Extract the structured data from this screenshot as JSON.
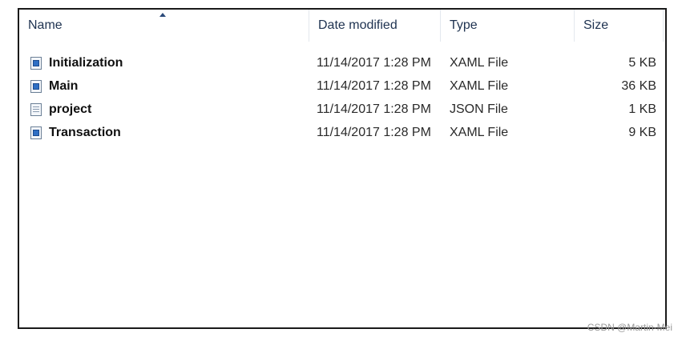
{
  "columns": {
    "name": "Name",
    "date": "Date modified",
    "type": "Type",
    "size": "Size"
  },
  "files": [
    {
      "name": "Initialization",
      "date": "11/14/2017 1:28 PM",
      "type": "XAML File",
      "size": "5 KB",
      "icon": "xaml-file-icon"
    },
    {
      "name": "Main",
      "date": "11/14/2017 1:28 PM",
      "type": "XAML File",
      "size": "36 KB",
      "icon": "xaml-file-icon"
    },
    {
      "name": "project",
      "date": "11/14/2017 1:28 PM",
      "type": "JSON File",
      "size": "1 KB",
      "icon": "json-file-icon"
    },
    {
      "name": "Transaction",
      "date": "11/14/2017 1:28 PM",
      "type": "XAML File",
      "size": "9 KB",
      "icon": "xaml-file-icon"
    }
  ],
  "watermark": "CSDN @Martin-Mei"
}
